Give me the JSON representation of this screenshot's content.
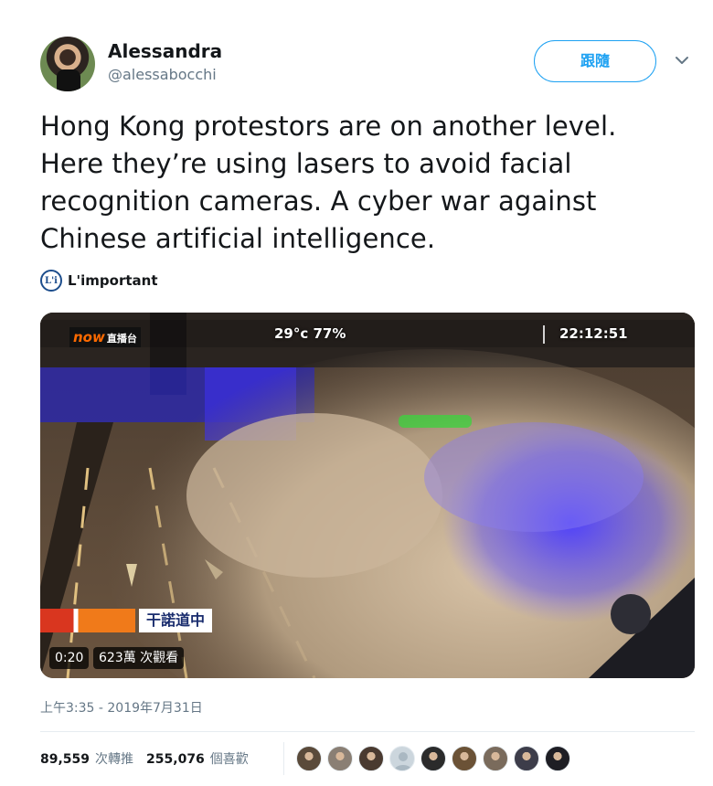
{
  "author": {
    "name": "Alessandra",
    "handle": "@alessabocchi",
    "follow_label": "跟隨"
  },
  "tweet": {
    "text": "Hong Kong protestors are on another level. Here they’re using lasers to avoid facial recognition cameras. A cyber war against Chinese artificial intelligence."
  },
  "source": {
    "logo_text": "L'i",
    "name": "L'important"
  },
  "video": {
    "channel_logo": "now",
    "channel_sub": "直播台",
    "weather": "29°c  77%",
    "clock": "22:12:51",
    "location": "干諾道中",
    "duration": "0:20",
    "views": "623萬 次觀看"
  },
  "timestamp": "上午3:35 - 2019年7月31日",
  "stats": {
    "retweets_count": "89,559",
    "retweets_label": "次轉推",
    "likes_count": "255,076",
    "likes_label": "個喜歡"
  },
  "likers": [
    {
      "icon": "avatar-photo",
      "color": "#5a4a3a"
    },
    {
      "icon": "avatar-photo",
      "color": "#8a7f74"
    },
    {
      "icon": "avatar-photo",
      "color": "#4a3a30"
    },
    {
      "icon": "default-avatar",
      "color": "#aab8c2"
    },
    {
      "icon": "avatar-photo",
      "color": "#2b2b2b"
    },
    {
      "icon": "avatar-photo",
      "color": "#6b5236"
    },
    {
      "icon": "avatar-photo",
      "color": "#7a6b5c"
    },
    {
      "icon": "avatar-photo",
      "color": "#3d3d4a"
    },
    {
      "icon": "avatar-photo",
      "color": "#1e1e24"
    }
  ],
  "colors": {
    "accent": "#1da1f2",
    "secondary_text": "#657786",
    "laser_blue": "#3a2cff",
    "laser_green": "#39d43c"
  }
}
